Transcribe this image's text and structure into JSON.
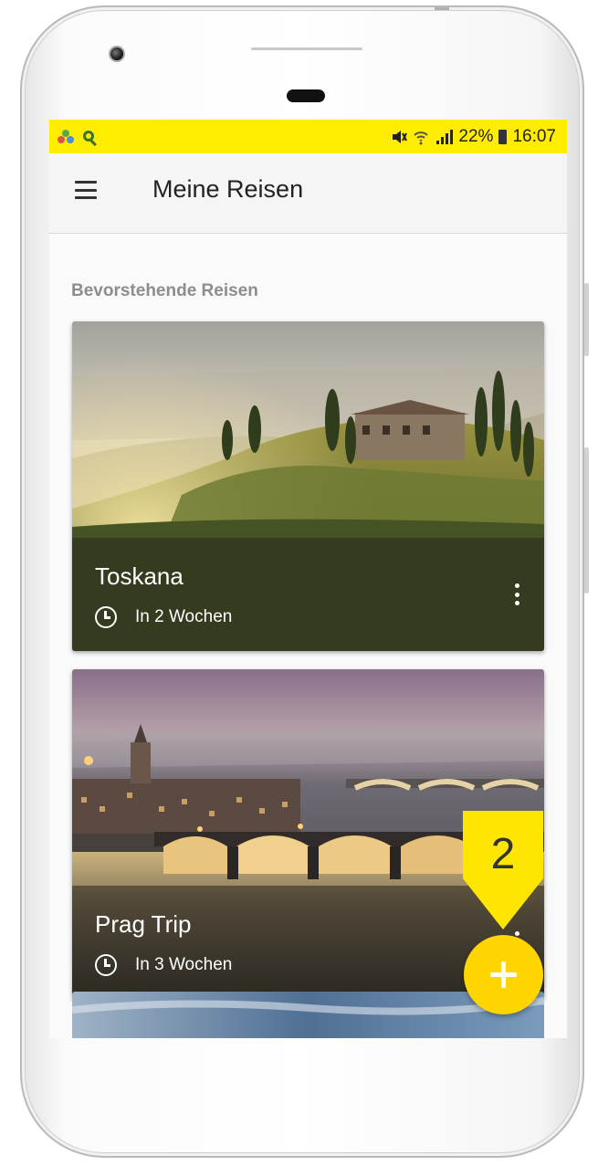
{
  "status_bar": {
    "battery": "22%",
    "time": "16:07",
    "background": "#ffed00",
    "icons": [
      "app-notification-icon",
      "search-notification-icon",
      "mute-icon",
      "wifi-icon",
      "signal-icon",
      "battery-icon"
    ]
  },
  "app_bar": {
    "title": "Meine Reisen",
    "menu_icon": "hamburger-menu-icon"
  },
  "main": {
    "section_title": "Bevorstehende Reisen",
    "trips": [
      {
        "title": "Toskana",
        "subtitle": "In 2 Wochen",
        "image": "tuscany-landscape"
      },
      {
        "title": "Prag Trip",
        "subtitle": "In 3 Wochen",
        "image": "prague-bridges-evening"
      }
    ]
  },
  "annotation": {
    "number": "2",
    "color": "#ffe600"
  },
  "fab": {
    "icon": "plus-icon",
    "color": "#ffd500"
  }
}
